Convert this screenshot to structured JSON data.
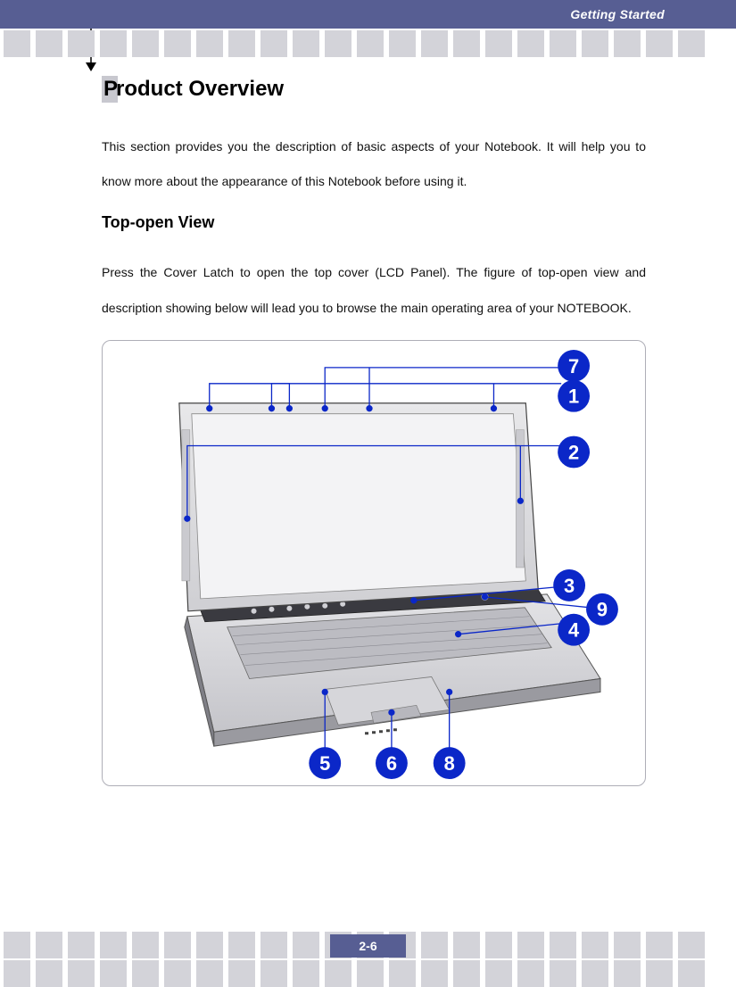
{
  "header": {
    "label": "Getting Started"
  },
  "page": {
    "number": "2-6"
  },
  "title": {
    "initial": "P",
    "rest": "roduct Overview"
  },
  "intro": "This section provides you the description of basic aspects of your Notebook.    It will help you to know more about the appearance of this Notebook before using it.",
  "subtitle": "Top-open View",
  "subintro": "Press the Cover Latch to open the top cover (LCD Panel). The figure of top-open view and description showing below will lead you to browse the main operating area of your NOTEBOOK.",
  "callouts": [
    "1",
    "2",
    "3",
    "4",
    "5",
    "6",
    "7",
    "8",
    "9"
  ]
}
